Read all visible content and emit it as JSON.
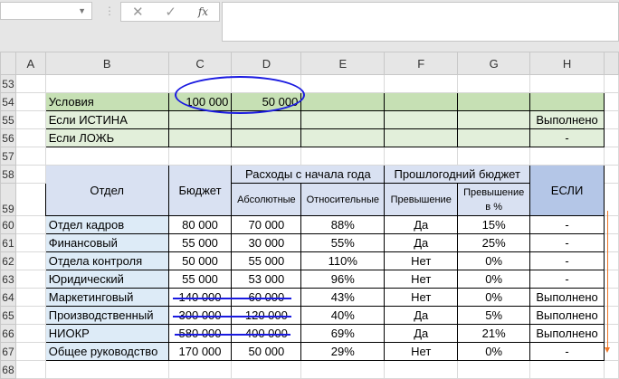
{
  "toolbar": {
    "name_box": "",
    "formula": "",
    "cancel_icon": "✕",
    "enter_icon": "✓",
    "fx_label": "fx"
  },
  "columns": [
    "A",
    "B",
    "C",
    "D",
    "E",
    "F",
    "G",
    "H"
  ],
  "rows": [
    "53",
    "54",
    "55",
    "56",
    "57",
    "58",
    "59",
    "60",
    "61",
    "62",
    "63",
    "64",
    "65",
    "66",
    "67",
    "68"
  ],
  "conditions": {
    "label": "Условия",
    "c": "100 000",
    "d": "50 000",
    "true_label": "Если ИСТИНА",
    "true_value": "Выполнено",
    "false_label": "Если ЛОЖЬ",
    "false_value": "-"
  },
  "table": {
    "headers": {
      "dept": "Отдел",
      "budget": "Бюджет",
      "expenses": "Расходы с начала года",
      "absolute": "Абсолютные",
      "relative": "Относительные",
      "last_year": "Прошлогодний бюджет",
      "excess": "Превышение",
      "excess_pct": "Превышение в %",
      "if": "ЕСЛИ"
    },
    "rows": [
      [
        "Отдел кадров",
        "80 000",
        "70 000",
        "88%",
        "Да",
        "15%",
        "-"
      ],
      [
        "Финансовый",
        "55 000",
        "30 000",
        "55%",
        "Да",
        "25%",
        "-"
      ],
      [
        "Отдела контроля",
        "50 000",
        "55 000",
        "110%",
        "Нет",
        "0%",
        "-"
      ],
      [
        "Юридический",
        "55 000",
        "53 000",
        "96%",
        "Нет",
        "0%",
        "-"
      ],
      [
        "Маркетинговый",
        "140 000",
        "60 000",
        "43%",
        "Нет",
        "0%",
        "Выполнено"
      ],
      [
        "Производственный",
        "300 000",
        "120 000",
        "40%",
        "Да",
        "5%",
        "Выполнено"
      ],
      [
        "НИОКР",
        "580 000",
        "400 000",
        "69%",
        "Да",
        "21%",
        "Выполнено"
      ],
      [
        "Общее руководство",
        "170 000",
        "50 000",
        "29%",
        "Нет",
        "0%",
        "-"
      ]
    ]
  },
  "annotation_colors": {
    "ellipse": "#1a1ae0",
    "underline": "#1a1ae0",
    "arrow": "#f07828"
  }
}
